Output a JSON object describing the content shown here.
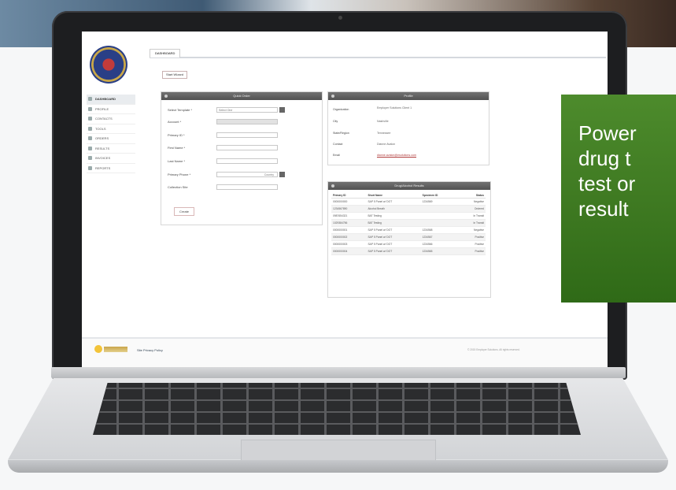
{
  "app": {
    "tab_label": "DASHBOARD",
    "top_button": "Start Wizard"
  },
  "sidebar": {
    "items": [
      {
        "label": "DASHBOARD",
        "icon": "home-icon",
        "active": true
      },
      {
        "label": "PROFILE",
        "icon": "user-icon",
        "active": false
      },
      {
        "label": "CONTACTS",
        "icon": "contacts-icon",
        "active": false
      },
      {
        "label": "TOOLS",
        "icon": "wrench-icon",
        "active": false
      },
      {
        "label": "ORDERS",
        "icon": "cart-icon",
        "active": false
      },
      {
        "label": "RESULTS",
        "icon": "chart-icon",
        "active": false
      },
      {
        "label": "INVOICES",
        "icon": "invoice-icon",
        "active": false
      },
      {
        "label": "REPORTS",
        "icon": "report-icon",
        "active": false
      }
    ]
  },
  "quick_order": {
    "title": "Quick Order",
    "fields": [
      {
        "label": "Select Template *",
        "value": "Select One",
        "type": "select"
      },
      {
        "label": "Account *",
        "value": "",
        "type": "disabled"
      },
      {
        "label": "Primary ID *",
        "value": "",
        "type": "text"
      },
      {
        "label": "First Name *",
        "value": "",
        "type": "text"
      },
      {
        "label": "Last Name *",
        "value": "",
        "type": "text"
      },
      {
        "label": "Primary Phone *",
        "value": "Country",
        "type": "select"
      },
      {
        "label": "Collection Site",
        "value": "",
        "type": "text"
      }
    ],
    "create_label": "Create"
  },
  "profile": {
    "title": "Profile",
    "rows": [
      {
        "label": "Organization",
        "value": "Employer Solutions Client 1",
        "link": false
      },
      {
        "label": "City",
        "value": "Nashville",
        "link": false
      },
      {
        "label": "State/Region",
        "value": "Tennessee",
        "link": false
      },
      {
        "label": "Contact",
        "value": "Dianne Avalon",
        "link": false
      },
      {
        "label": "Email",
        "value": "dianne.avalon@esolutions.com",
        "link": true
      }
    ]
  },
  "results": {
    "title": "Drug/Alcohol Results",
    "columns": [
      "Primary ID",
      "Short Name",
      "Specimen ID",
      "Status"
    ],
    "rows": [
      [
        "0000000000",
        "SAP 5 Panel w/ DOT",
        "1234569",
        "Negative"
      ],
      [
        "1234567890",
        "Alcohol Breath",
        "",
        "Ordered"
      ],
      [
        "0987654321",
        "BAT Testing",
        "",
        "In Transit"
      ],
      [
        "1029384756",
        "BAT Testing",
        "",
        "In Transit"
      ],
      [
        "0000000001",
        "SAP 5 Panel w/ DOT",
        "1234568",
        "Negative"
      ],
      [
        "0000000002",
        "SAP 5 Panel w/ DOT",
        "1234567",
        "Positive"
      ],
      [
        "0000000003",
        "SAP 5 Panel w/ DOT",
        "1234566",
        "Positive"
      ],
      [
        "0000000004",
        "SAP 5 Panel w/ DOT",
        "1234565",
        "Positive"
      ]
    ]
  },
  "footer": {
    "link": "Site Privacy Policy",
    "copyright": "© 2015 Employer Solutions. All rights reserved."
  },
  "promo": {
    "lines": [
      "Power",
      "drug t",
      "test or",
      "result"
    ]
  },
  "colors": {
    "promo_green": "#3f7a22",
    "panel_header": "#5f5f5f",
    "link_red": "#b03a3a"
  }
}
